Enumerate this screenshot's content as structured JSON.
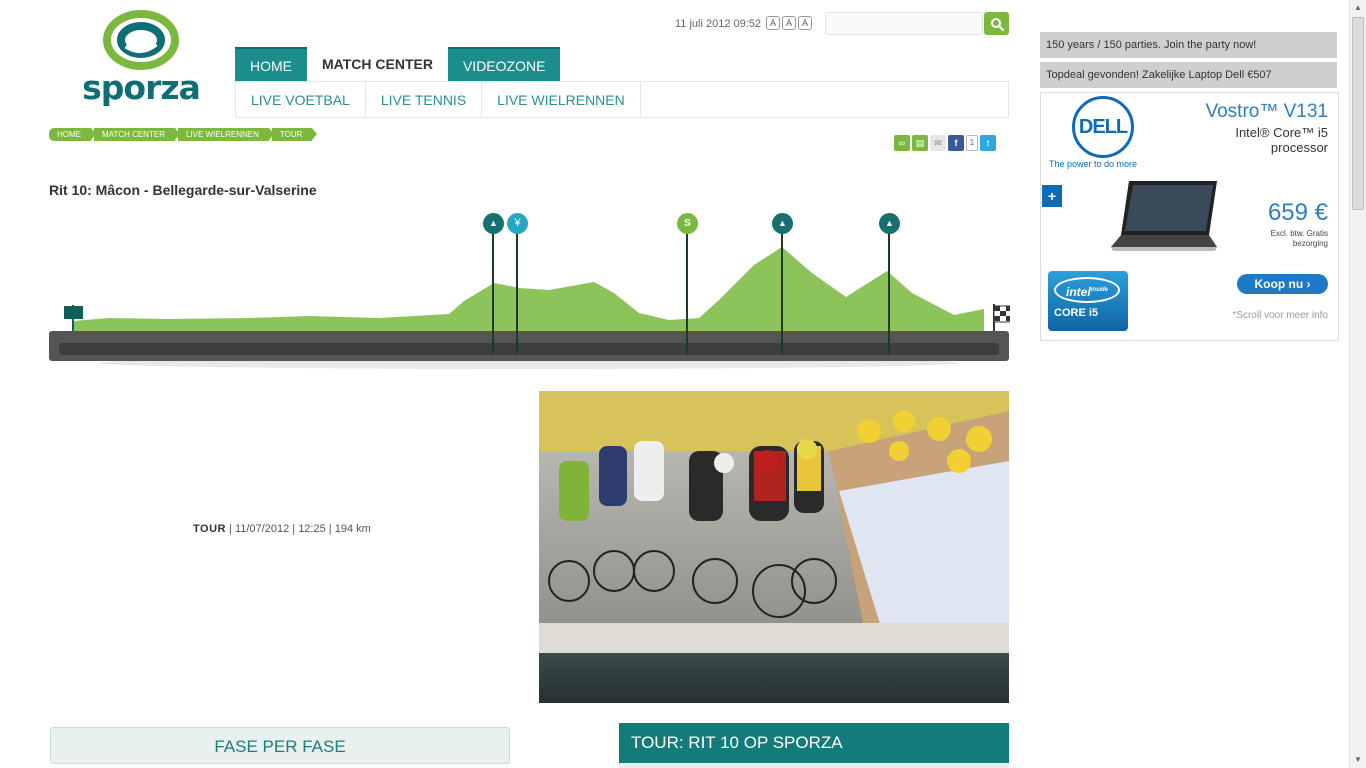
{
  "header": {
    "logo_text": "sporza",
    "datetime": "11 juli 2012 09:52",
    "font_sizes": [
      "A",
      "A",
      "A"
    ],
    "search_placeholder": ""
  },
  "nav": {
    "main": [
      "HOME",
      "MATCH CENTER",
      "VIDEOZONE"
    ],
    "active_main": "MATCH CENTER",
    "sub": [
      "LIVE VOETBAL",
      "LIVE TENNIS",
      "LIVE WIELRENNEN"
    ]
  },
  "breadcrumb": [
    "HOME",
    "MATCH CENTER",
    "LIVE WIELRENNEN",
    "TOUR"
  ],
  "share": {
    "facebook_count": "1"
  },
  "stage": {
    "title": "Rit 10: Mâcon - Bellegarde-sur-Valserine",
    "label": "TOUR",
    "date": "11/07/2012",
    "time": "12:25",
    "distance": "194 km"
  },
  "profile_markers": [
    {
      "type": "climb",
      "glyph": "▲"
    },
    {
      "type": "feed",
      "glyph": "¥"
    },
    {
      "type": "sprint",
      "glyph": "S"
    },
    {
      "type": "climb",
      "glyph": "▲"
    },
    {
      "type": "climb",
      "glyph": "▲"
    }
  ],
  "sections": {
    "phase": "FASE PER FASE",
    "tour_box": "TOUR: RIT 10 OP SPORZA"
  },
  "ads": {
    "bar1": "150 years / 150 parties. Join the party now!",
    "bar2": "Topdeal gevonden! Zakelijke Laptop Dell €507",
    "dell_logo": "DELL",
    "dell_tagline": "The power to do more",
    "product": "Vostro™ V131",
    "processor": "Intel® Core™ i5 processor",
    "plus": "+",
    "price": "659 €",
    "price_note": "Excl. btw. Gratis bezorging",
    "cta": "Koop nu",
    "intel_brand": "intel",
    "intel_inside": "inside",
    "intel_core": "CORE i5",
    "scroll_note": "*Scroll voor meer info"
  },
  "colors": {
    "brand_teal": "#1b8d8c",
    "accent_green": "#7ab83e",
    "dell_blue": "#0c6bb5"
  }
}
